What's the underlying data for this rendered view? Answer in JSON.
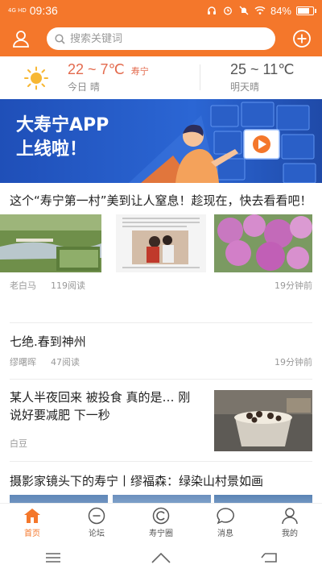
{
  "status_bar": {
    "network": "4G HD",
    "time": "09:36",
    "battery": "84%",
    "battery_level": 0.84
  },
  "search": {
    "placeholder": "搜索关键词"
  },
  "weather": {
    "today_temp": "22 ~ 7℃",
    "city": "寿宁",
    "today_desc": "今日 晴",
    "tomorrow_temp": "25 ~ 11℃",
    "tomorrow_desc": "明天晴"
  },
  "banner": {
    "line1": "大寿宁APP",
    "line2": "上线啦！"
  },
  "articles": [
    {
      "title": "这个“寿宁第一村”美到让人窒息！趁现在，快去看看吧！",
      "author": "老白马",
      "views": "119阅读",
      "time": "19分钟前"
    },
    {
      "title": "七绝.春到神州",
      "author": "缪曙晖",
      "views": "47阅读",
      "time": "19分钟前"
    },
    {
      "title": "某人半夜回来 被投食 真的是… 刚说好要减肥 下一秒",
      "author": "白豆"
    },
    {
      "title": "摄影家镜头下的寿宁丨缪福森：绿染山村景如画"
    }
  ],
  "bottom_nav": [
    {
      "label": "首页",
      "icon": "home-icon",
      "active": true
    },
    {
      "label": "论坛",
      "icon": "forum-icon"
    },
    {
      "label": "寿宁圈",
      "icon": "circle-icon"
    },
    {
      "label": "消息",
      "icon": "message-icon"
    },
    {
      "label": "我的",
      "icon": "profile-icon"
    }
  ],
  "colors": {
    "brand": "#f4772b",
    "temp_today": "#e36a4d",
    "banner_blue": "#2b66d4"
  }
}
